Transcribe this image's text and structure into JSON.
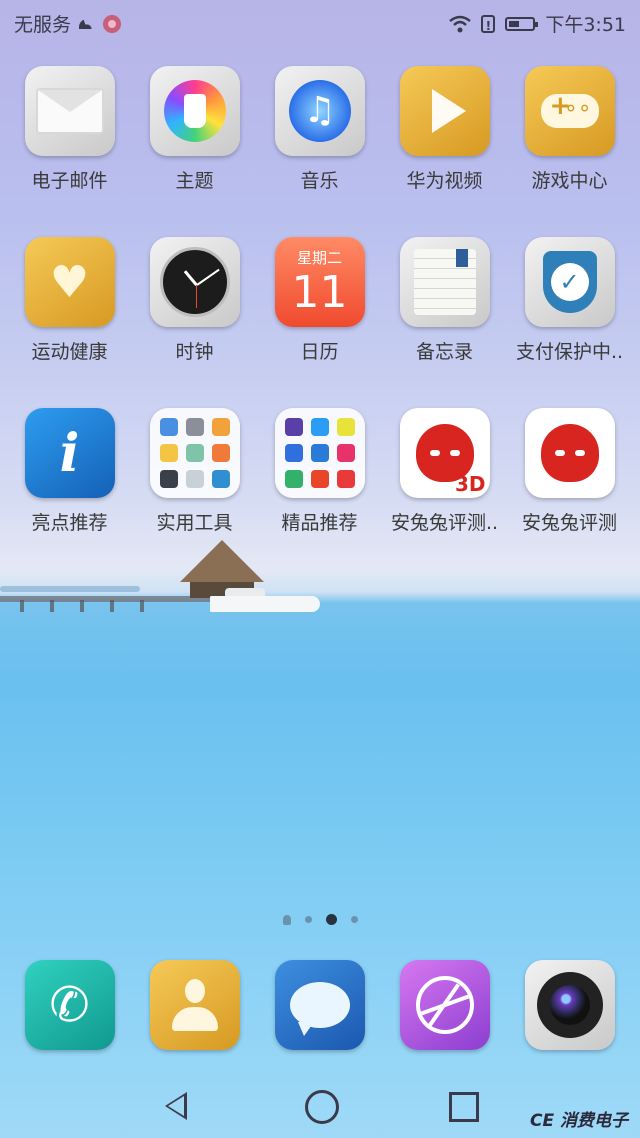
{
  "status_bar": {
    "carrier": "无服务",
    "time": "下午3:51"
  },
  "apps": [
    {
      "label": "电子邮件",
      "icon": "email-icon"
    },
    {
      "label": "主题",
      "icon": "theme-brush-icon"
    },
    {
      "label": "音乐",
      "icon": "music-note-icon"
    },
    {
      "label": "华为视频",
      "icon": "video-play-icon"
    },
    {
      "label": "游戏中心",
      "icon": "gamepad-icon"
    },
    {
      "label": "运动健康",
      "icon": "health-heart-icon"
    },
    {
      "label": "时钟",
      "icon": "clock-icon"
    },
    {
      "label": "日历",
      "icon": "calendar-icon"
    },
    {
      "label": "备忘录",
      "icon": "notepad-icon"
    },
    {
      "label": "支付保护中..",
      "icon": "shield-check-icon"
    },
    {
      "label": "亮点推荐",
      "icon": "info-icon"
    },
    {
      "label": "实用工具",
      "icon": "folder-icon"
    },
    {
      "label": "精品推荐",
      "icon": "folder-icon"
    },
    {
      "label": "安兔兔评测..",
      "icon": "antutu-3d-icon"
    },
    {
      "label": "安兔兔评测",
      "icon": "antutu-icon"
    }
  ],
  "calendar": {
    "weekday": "星期二",
    "day": "11"
  },
  "antutu_3d_tag": "3D",
  "dock": [
    {
      "icon": "phone-icon"
    },
    {
      "icon": "contacts-icon"
    },
    {
      "icon": "messages-icon"
    },
    {
      "icon": "browser-icon"
    },
    {
      "icon": "camera-icon"
    }
  ],
  "page_indicator": {
    "count": 3,
    "active_index": 1
  },
  "watermark": "CE 消费电子",
  "colors": {
    "calendar_red": "#f04a2e",
    "antutu_red": "#d9251f",
    "gold": "#d69a22"
  }
}
